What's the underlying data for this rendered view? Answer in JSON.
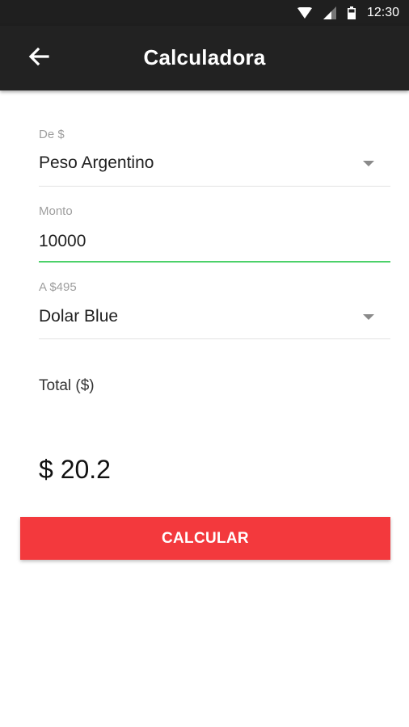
{
  "status_bar": {
    "time": "12:30",
    "icons": [
      "wifi-icon",
      "signal-icon",
      "battery-icon"
    ]
  },
  "app_bar": {
    "title": "Calculadora",
    "back_icon": "arrow-left-icon"
  },
  "form": {
    "from": {
      "label": "De $",
      "value": "Peso Argentino"
    },
    "amount": {
      "label": "Monto",
      "value": "10000"
    },
    "to": {
      "label": "A $495",
      "value": "Dolar Blue"
    },
    "total_label": "Total ($)",
    "total_value": "$ 20.2"
  },
  "calc_button": {
    "label": "CALCULAR"
  },
  "colors": {
    "app_bar": "#222222",
    "accent_green": "#4cd169",
    "button_red": "#f3393d"
  }
}
